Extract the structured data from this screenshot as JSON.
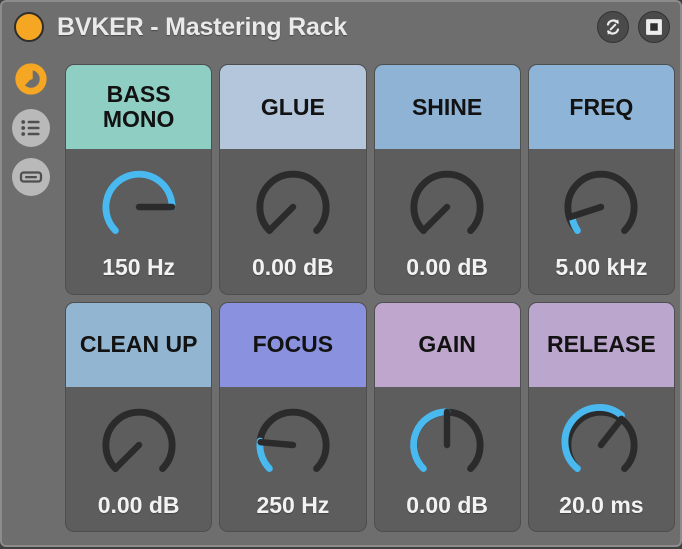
{
  "window": {
    "title": "BVKER - Mastering Rack",
    "led_color": "#f5a623",
    "background": "#6e6e6e",
    "accent_color": "#4ab9ef"
  },
  "titlebar": {
    "buttons": [
      {
        "name": "randomize-button",
        "icon": "refresh-arrows-icon"
      },
      {
        "name": "save-button",
        "icon": "floppy-disk-icon"
      }
    ]
  },
  "sidebar": {
    "items": [
      {
        "name": "macro-view-button",
        "icon": "macro-knob-icon",
        "active": true,
        "color": "#f5a623"
      },
      {
        "name": "chain-list-button",
        "icon": "list-icon",
        "active": false,
        "color": "#b9b9b9"
      },
      {
        "name": "device-view-button",
        "icon": "device-panel-icon",
        "active": false,
        "color": "#b9b9b9"
      }
    ]
  },
  "macros": [
    {
      "id": "bass-mono",
      "label": "BASS MONO",
      "header_color": "#8fcec2",
      "value": "150 Hz",
      "knob": {
        "fill_start_deg": -135,
        "pointer_deg": 90,
        "bipolar": false
      }
    },
    {
      "id": "glue",
      "label": "GLUE",
      "header_color": "#b4c6dc",
      "value": "0.00 dB",
      "knob": {
        "fill_start_deg": -135,
        "pointer_deg": -135,
        "bipolar": false
      }
    },
    {
      "id": "shine",
      "label": "SHINE",
      "header_color": "#8fb3d4",
      "value": "0.00 dB",
      "knob": {
        "fill_start_deg": -135,
        "pointer_deg": -135,
        "bipolar": false
      }
    },
    {
      "id": "freq",
      "label": "FREQ",
      "header_color": "#8eb4d8",
      "value": "5.00 kHz",
      "knob": {
        "fill_start_deg": -135,
        "pointer_deg": -108,
        "bipolar": false
      }
    },
    {
      "id": "clean-up",
      "label": "CLEAN UP",
      "header_color": "#92b6d2",
      "value": "0.00 dB",
      "knob": {
        "fill_start_deg": -135,
        "pointer_deg": -135,
        "bipolar": false
      }
    },
    {
      "id": "focus",
      "label": "FOCUS",
      "header_color": "#8a92e0",
      "value": "250 Hz",
      "knob": {
        "fill_start_deg": -135,
        "pointer_deg": -85,
        "bipolar": false
      }
    },
    {
      "id": "gain",
      "label": "GAIN",
      "header_color": "#bfa6cd",
      "value": "0.00 dB",
      "knob": {
        "fill_start_deg": -135,
        "pointer_deg": 0,
        "bipolar": true
      }
    },
    {
      "id": "release",
      "label": "RELEASE",
      "header_color": "#bba6ce",
      "value": "20.0 ms",
      "knob": {
        "fill_start_deg": -135,
        "pointer_deg": 38,
        "bipolar": false
      }
    }
  ]
}
